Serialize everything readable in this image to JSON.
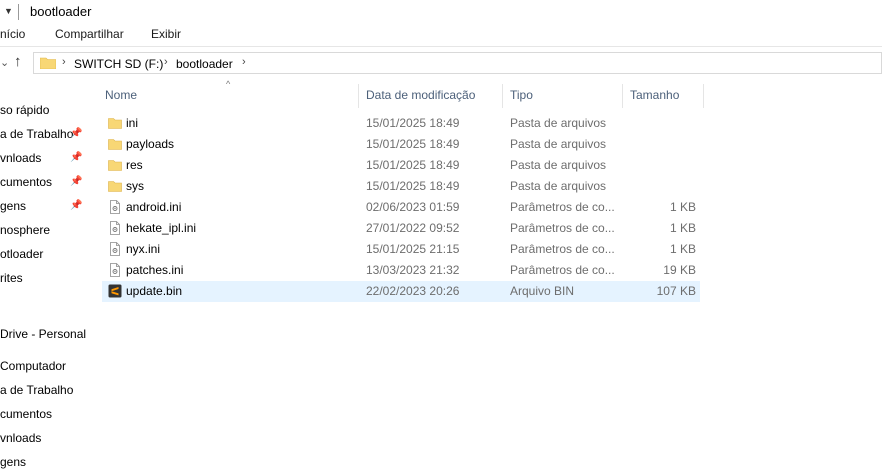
{
  "window": {
    "title": "bootloader"
  },
  "ribbon": {
    "tabs": [
      "Início",
      "Compartilhar",
      "Exibir"
    ]
  },
  "tabs_visible": [
    "nício",
    "Compartilhar",
    "Exibir"
  ],
  "address": {
    "crumbs": [
      "SWITCH SD (F:)",
      "bootloader"
    ]
  },
  "sidebar": {
    "items": [
      {
        "label": "so rápido",
        "pinned": false
      },
      {
        "label": "a de Trabalho",
        "pinned": true
      },
      {
        "label": "vnloads",
        "pinned": true
      },
      {
        "label": "cumentos",
        "pinned": true
      },
      {
        "label": "gens",
        "pinned": true
      },
      {
        "label": "nosphere",
        "pinned": false
      },
      {
        "label": "otloader",
        "pinned": false
      },
      {
        "label": "rites",
        "pinned": false
      },
      {
        "label": "Drive - Personal",
        "pinned": false
      },
      {
        "label": "Computador",
        "pinned": false
      },
      {
        "label": "a de Trabalho",
        "pinned": false
      },
      {
        "label": "cumentos",
        "pinned": false
      },
      {
        "label": "vnloads",
        "pinned": false
      },
      {
        "label": "gens",
        "pinned": false
      }
    ]
  },
  "columns": {
    "name": "Nome",
    "date": "Data de modificação",
    "type": "Tipo",
    "size": "Tamanho"
  },
  "files": [
    {
      "name": "ini",
      "date": "15/01/2025 18:49",
      "type": "Pasta de arquivos",
      "size": "",
      "icon": "folder-icon"
    },
    {
      "name": "payloads",
      "date": "15/01/2025 18:49",
      "type": "Pasta de arquivos",
      "size": "",
      "icon": "folder-icon"
    },
    {
      "name": "res",
      "date": "15/01/2025 18:49",
      "type": "Pasta de arquivos",
      "size": "",
      "icon": "folder-icon"
    },
    {
      "name": "sys",
      "date": "15/01/2025 18:49",
      "type": "Pasta de arquivos",
      "size": "",
      "icon": "folder-icon"
    },
    {
      "name": "android.ini",
      "date": "02/06/2023 01:59",
      "type": "Parâmetros de co...",
      "size": "1 KB",
      "icon": "ini-file-icon"
    },
    {
      "name": "hekate_ipl.ini",
      "date": "27/01/2022 09:52",
      "type": "Parâmetros de co...",
      "size": "1 KB",
      "icon": "ini-file-icon"
    },
    {
      "name": "nyx.ini",
      "date": "15/01/2025 21:15",
      "type": "Parâmetros de co...",
      "size": "1 KB",
      "icon": "ini-file-icon"
    },
    {
      "name": "patches.ini",
      "date": "13/03/2023 21:32",
      "type": "Parâmetros de co...",
      "size": "19 KB",
      "icon": "ini-file-icon"
    },
    {
      "name": "update.bin",
      "date": "22/02/2023 20:26",
      "type": "Arquivo BIN",
      "size": "107 KB",
      "icon": "sublime-file-icon"
    }
  ],
  "colors": {
    "folder": "#f8d775",
    "selected_row": "#e5f3ff",
    "header_text": "#4c607a",
    "sublime_bg": "#333333",
    "sublime_accent": "#ff9800"
  }
}
